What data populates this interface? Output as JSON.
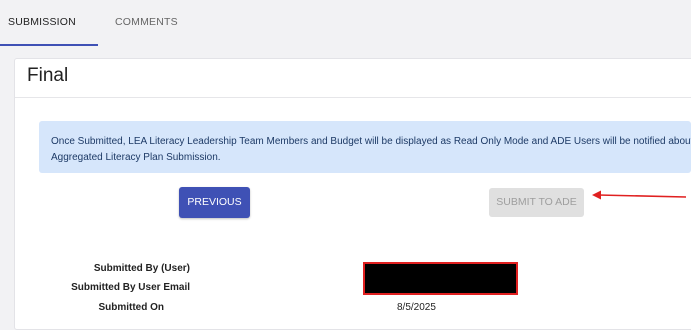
{
  "tabs": [
    {
      "label": "SUBMISSION",
      "active": true
    },
    {
      "label": "COMMENTS",
      "active": false
    }
  ],
  "card": {
    "title": "Final"
  },
  "info_banner": {
    "text": "Once Submitted, LEA Literacy Leadership Team Members and Budget will be displayed as Read Only Mode and ADE Users will be notified about Aggregated Literacy Plan Submission."
  },
  "buttons": {
    "previous_label": "PREVIOUS",
    "submit_label": "SUBMIT TO ADE",
    "submit_disabled": true
  },
  "details": {
    "submitted_by_label": "Submitted By (User)",
    "submitted_by_email_label": "Submitted By User Email",
    "submitted_on_label": "Submitted On",
    "submitted_on_value": "8/5/2025"
  },
  "colors": {
    "primary": "#3f51b5",
    "info_bg": "#d6e6fb",
    "annotation_red": "#e02020",
    "disabled_bg": "#e0e0e0"
  }
}
